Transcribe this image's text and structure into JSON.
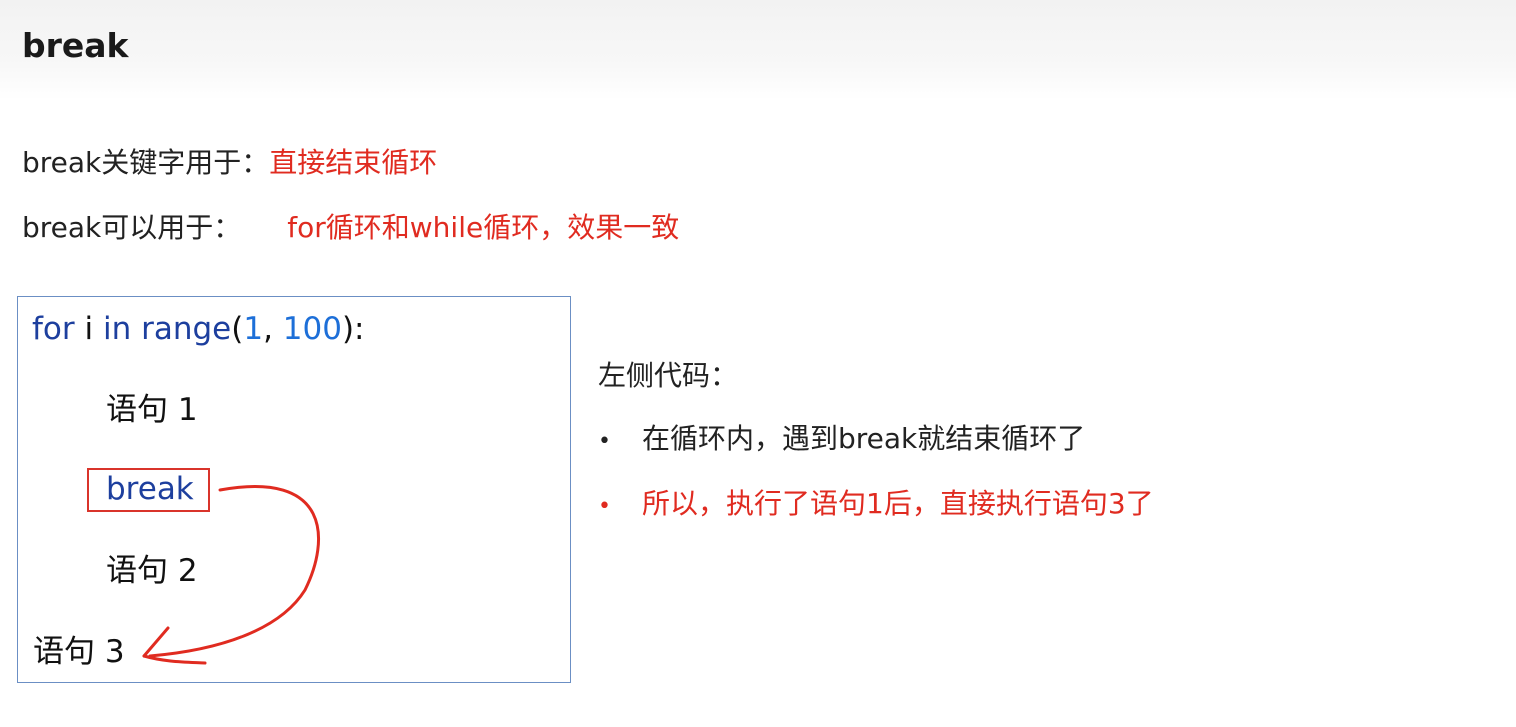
{
  "title": "break",
  "intro": {
    "line1": {
      "label": "break关键字用于：",
      "value": "直接结束循环"
    },
    "line2": {
      "label": "break可以用于：",
      "value": "for循环和while循环，效果一致"
    }
  },
  "code": {
    "for_kw": "for",
    "for_var": " i ",
    "in_kw": "in",
    "range_fn": " range",
    "paren_open": "(",
    "arg1": "1",
    "comma": ", ",
    "arg2": "100",
    "paren_close": "):",
    "stmt1": "语句 1",
    "break_kw": "break",
    "stmt2": "语句 2",
    "stmt3": "语句 3"
  },
  "explanation": {
    "heading": "左侧代码：",
    "bullets": [
      {
        "marker": "•",
        "text": "在循环内，遇到break就结束循环了"
      },
      {
        "marker": "•",
        "text": "所以，执行了语句1后，直接执行语句3了"
      }
    ]
  },
  "colors": {
    "accent_red": "#e02b20",
    "code_keyword": "#1d3f9e",
    "code_number": "#1d6fd8",
    "box_border": "#6b8fc4"
  }
}
